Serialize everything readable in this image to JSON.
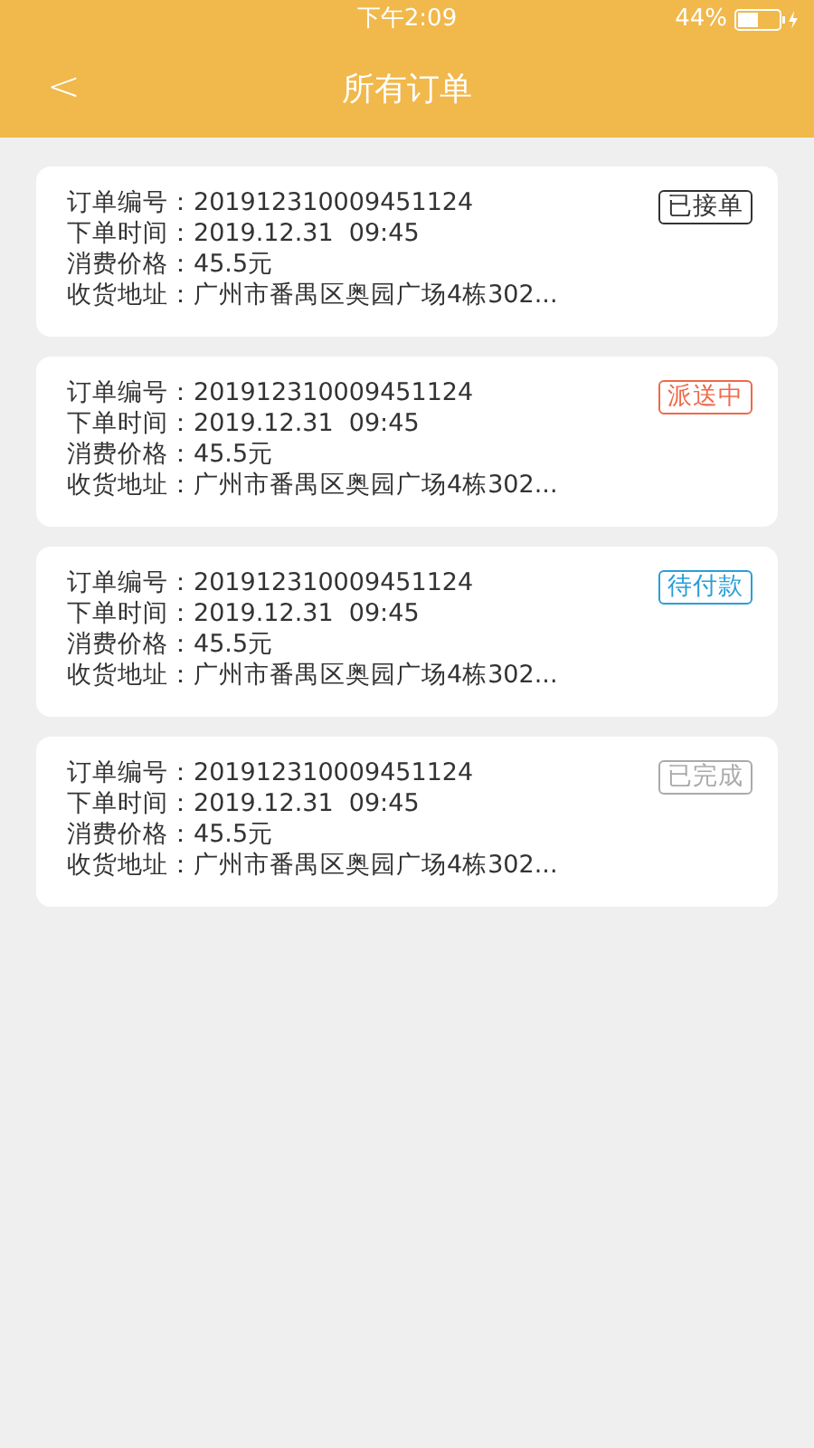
{
  "status_bar": {
    "time": "下午2:09",
    "battery": "44%"
  },
  "nav": {
    "back": "<",
    "title": "所有订单"
  },
  "orders": [
    {
      "fields": [
        {
          "label": "订单编号：",
          "value": "201912310009451124"
        },
        {
          "label": "下单时间：",
          "value": "2019.12.31  09:45"
        },
        {
          "label": "消费价格：",
          "value": "45.5元"
        },
        {
          "label": "收货地址：",
          "value": "广州市番禺区奥园广场4栋302..."
        }
      ],
      "status": "已接单",
      "color": "#333333"
    },
    {
      "fields": [
        {
          "label": "订单编号：",
          "value": "201912310009451124"
        },
        {
          "label": "下单时间：",
          "value": "2019.12.31  09:45"
        },
        {
          "label": "消费价格：",
          "value": "45.5元"
        },
        {
          "label": "收货地址：",
          "value": "广州市番禺区奥园广场4栋302..."
        }
      ],
      "status": "派送中",
      "color": "#f0694a"
    },
    {
      "fields": [
        {
          "label": "订单编号：",
          "value": "201912310009451124"
        },
        {
          "label": "下单时间：",
          "value": "2019.12.31  09:45"
        },
        {
          "label": "消费价格：",
          "value": "45.5元"
        },
        {
          "label": "收货地址：",
          "value": "广州市番禺区奥园广场4栋302..."
        }
      ],
      "status": "待付款",
      "color": "#2a9ed8"
    },
    {
      "fields": [
        {
          "label": "订单编号：",
          "value": "201912310009451124"
        },
        {
          "label": "下单时间：",
          "value": "2019.12.31  09:45"
        },
        {
          "label": "消费价格：",
          "value": "45.5元"
        },
        {
          "label": "收货地址：",
          "value": "广州市番禺区奥园广场4栋302..."
        }
      ],
      "status": "已完成",
      "color": "#aaaaaa"
    }
  ]
}
